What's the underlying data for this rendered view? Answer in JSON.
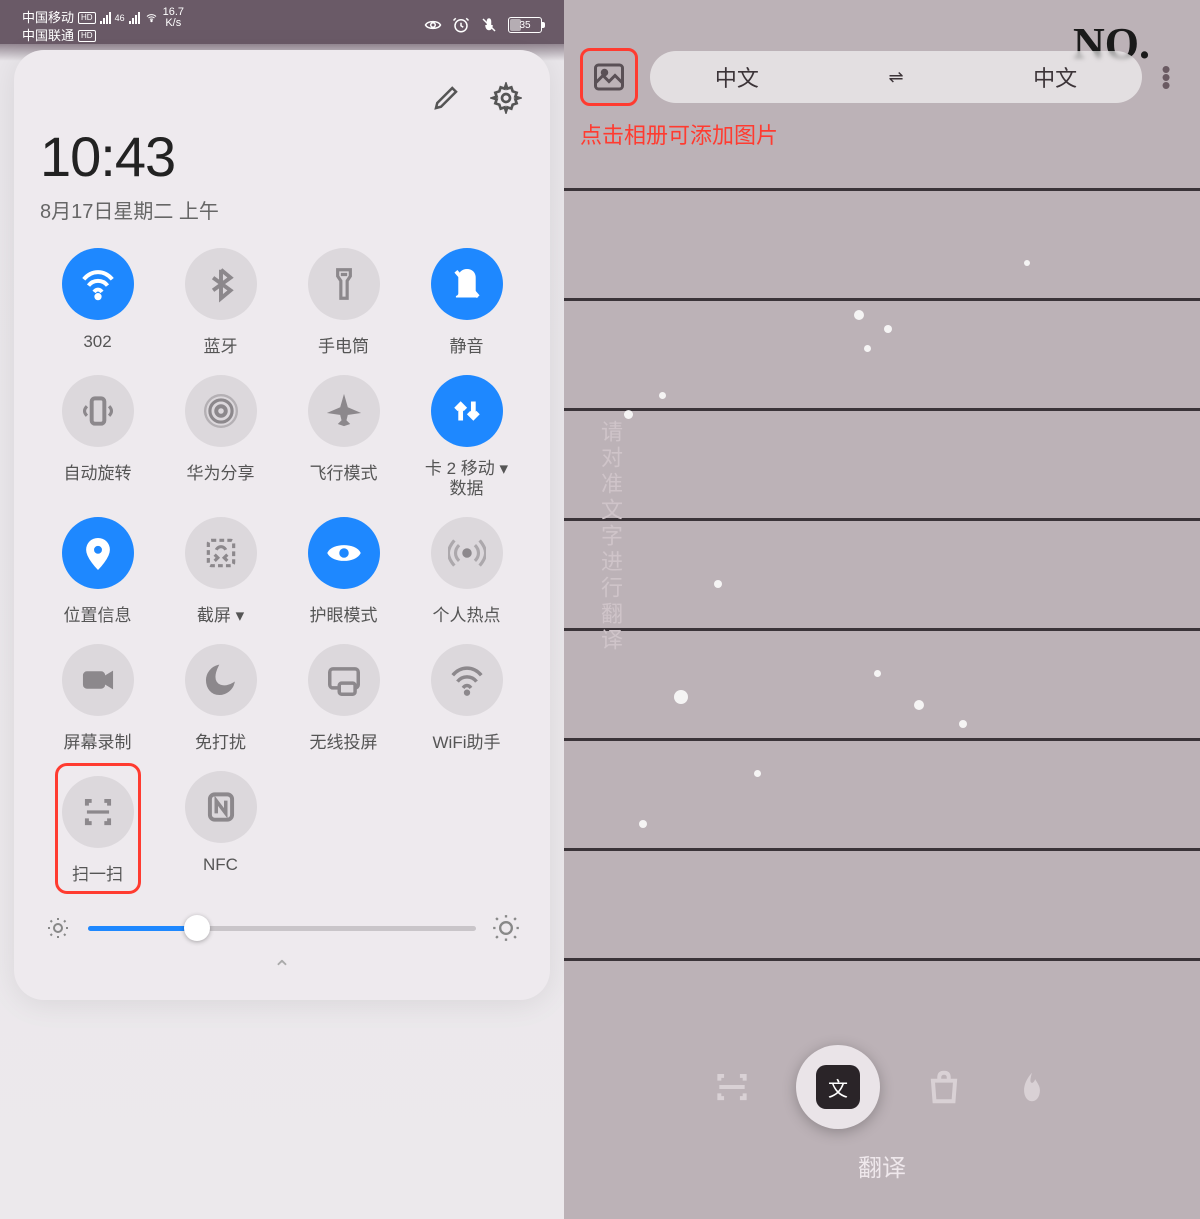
{
  "left": {
    "status": {
      "carrier1": "中国移动",
      "carrier2": "中国联通",
      "hd": "HD",
      "net4g": "46",
      "speed_top": "16.7",
      "speed_unit": "K/s",
      "battery": "35"
    },
    "time": "10:43",
    "date": "8月17日星期二 上午",
    "tiles": [
      {
        "label": "302",
        "state": "on",
        "icon": "wifi"
      },
      {
        "label": "蓝牙",
        "state": "off",
        "icon": "bluetooth"
      },
      {
        "label": "手电筒",
        "state": "off",
        "icon": "flashlight"
      },
      {
        "label": "静音",
        "state": "on",
        "icon": "mute"
      },
      {
        "label": "自动旋转",
        "state": "off",
        "icon": "rotate"
      },
      {
        "label": "华为分享",
        "state": "off",
        "icon": "share"
      },
      {
        "label": "飞行模式",
        "state": "off",
        "icon": "airplane"
      },
      {
        "label": "卡 2 移动 ▾\n数据",
        "state": "on",
        "icon": "data",
        "multi": true
      },
      {
        "label": "位置信息",
        "state": "on",
        "icon": "location"
      },
      {
        "label": "截屏 ▾",
        "state": "off",
        "icon": "screenshot"
      },
      {
        "label": "护眼模式",
        "state": "on",
        "icon": "eye"
      },
      {
        "label": "个人热点",
        "state": "off",
        "icon": "hotspot"
      },
      {
        "label": "屏幕录制",
        "state": "off",
        "icon": "record"
      },
      {
        "label": "免打扰",
        "state": "off",
        "icon": "dnd"
      },
      {
        "label": "无线投屏",
        "state": "off",
        "icon": "cast"
      },
      {
        "label": "WiFi助手",
        "state": "off",
        "icon": "wifihelp"
      },
      {
        "label": "扫一扫",
        "state": "off",
        "icon": "scan",
        "highlight": true
      },
      {
        "label": "NFC",
        "state": "off",
        "icon": "nfc"
      }
    ],
    "brightness": 28
  },
  "right": {
    "no_label": "NO.",
    "hint_red": "点击相册可添加图片",
    "hint_vertical": "请对准文字进行翻译",
    "lang_from": "中文",
    "lang_to": "中文",
    "swap": "⇌",
    "translate_label": "翻译",
    "translate_char": "文"
  }
}
